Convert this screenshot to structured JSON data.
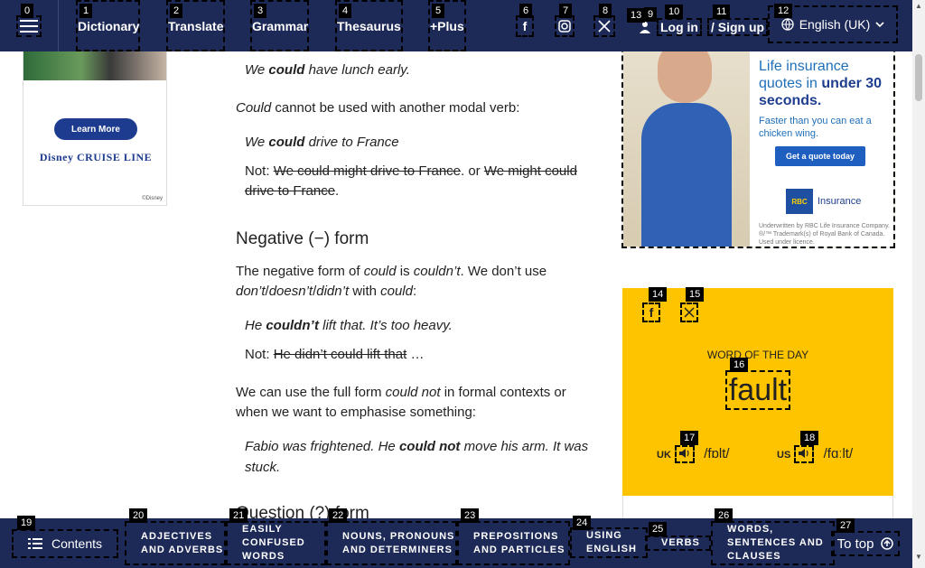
{
  "header": {
    "menu_icon": "hamburger-icon",
    "nav": [
      {
        "label": "Dictionary",
        "badge": "1"
      },
      {
        "label": "Translate",
        "badge": "2"
      },
      {
        "label": "Grammar",
        "badge": "3"
      },
      {
        "label": "Thesaurus",
        "badge": "4"
      },
      {
        "label": "+Plus",
        "badge": "5"
      }
    ],
    "social": [
      {
        "icon": "facebook-icon",
        "badge": "6"
      },
      {
        "icon": "instagram-icon",
        "badge": "7"
      },
      {
        "icon": "x-icon",
        "badge": "8"
      }
    ],
    "login_badge_a": "9",
    "login_badge_b": "13",
    "login_label": "Log in",
    "signup_label": "/ Sign up",
    "signup_badge_a": "10",
    "signup_badge_b": "11",
    "language_label": "English (UK)",
    "language_badge": "12",
    "menu_badge": "0"
  },
  "left_ad": {
    "button": "Learn More",
    "brand": "Disney CRUISE LINE",
    "copyright": "©Disney"
  },
  "article": {
    "ex1": {
      "pre": "We ",
      "bold": "could",
      "post": " have lunch early."
    },
    "p1": {
      "italic": "Could",
      "rest": " cannot be used with another modal verb:"
    },
    "ex2": {
      "pre": "We ",
      "bold": "could",
      "post": " drive to France"
    },
    "not1": {
      "not": "Not: ",
      "strike1": "We could might drive to France",
      "or": ". or ",
      "strike2": "We might could drive to France",
      "end": "."
    },
    "h_negative": "Negative (−) form",
    "p2": {
      "a": "The negative form of ",
      "b": "could",
      "c": " is ",
      "d": "couldn’t",
      "e": ". We don’t use ",
      "f": "don’t",
      "g": "/",
      "h": "doesn’t",
      "i": "/",
      "j": "didn’t",
      "k": " with ",
      "l": "could",
      "m": ":"
    },
    "ex3": {
      "pre": "He ",
      "bold": "couldn’t",
      "post": " lift that. It’s too heavy."
    },
    "not2": {
      "not": "Not: ",
      "strike": "He didn’t could lift that",
      "end": " …"
    },
    "p3": {
      "a": "We can use the full form ",
      "b": "could not",
      "c": " in formal contexts or when we want to emphasise something:"
    },
    "ex4": {
      "pre": "Fabio was frightened. He ",
      "bold": "could not",
      "post": " move his arm. It was stuck."
    },
    "h_question": "Question (?) form"
  },
  "right_ad": {
    "headline_a": "Life insurance quotes in ",
    "headline_b": "under 30 seconds.",
    "sub": "Faster than you can eat a chicken wing.",
    "cta": "Get a quote today",
    "logo": "RBC",
    "insurance": "Insurance",
    "fine": "Underwritten by RBC Life Insurance Company. ®/™ Trademark(s) of Royal Bank of Canada. Used under licence."
  },
  "wotd": {
    "facebook_badge": "14",
    "x_badge": "15",
    "label": "WORD OF THE DAY",
    "word": "fault",
    "word_badge": "16",
    "uk_label": "UK",
    "uk_pron": "/fɒlt/",
    "uk_badge": "17",
    "us_label": "US",
    "us_pron": "/fɑːlt/",
    "us_badge": "18"
  },
  "bottom": {
    "contents_label": "Contents",
    "contents_badge": "19",
    "items": [
      {
        "label": "ADJECTIVES AND ADVERBS",
        "badge": "20"
      },
      {
        "label": "EASILY CONFUSED WORDS",
        "badge": "21"
      },
      {
        "label": "NOUNS, PRONOUNS AND DETERMINERS",
        "badge": "22"
      },
      {
        "label": "PREPOSITIONS AND PARTICLES",
        "badge": "23"
      },
      {
        "label": "USING ENGLISH",
        "badge": "24"
      },
      {
        "label": "VERBS",
        "badge": "25"
      },
      {
        "label": "WORDS, SENTENCES AND CLAUSES",
        "badge": "26"
      }
    ],
    "to_top_label": "To top",
    "to_top_badge": "27"
  },
  "colors": {
    "header": "#1d2a57",
    "wotd": "#fec400"
  }
}
